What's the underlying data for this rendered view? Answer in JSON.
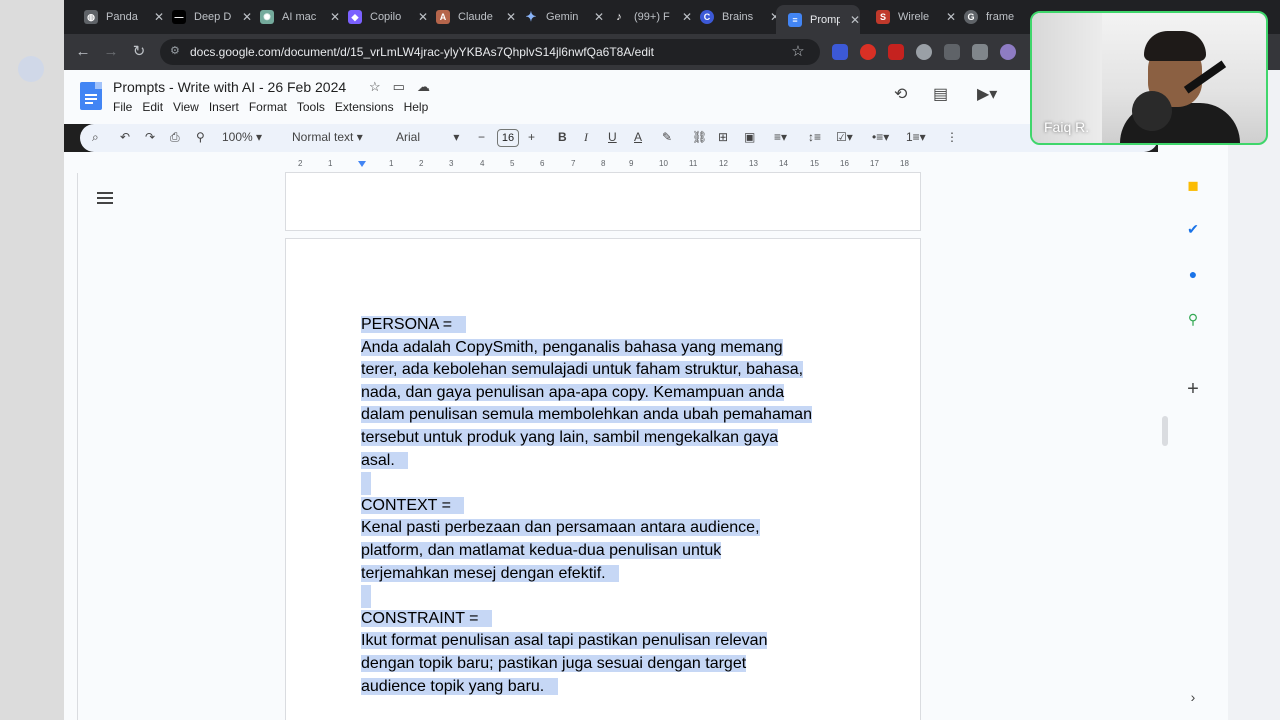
{
  "browser": {
    "tabs": [
      {
        "title": "Panda",
        "icon": "globe-icon",
        "color": "#5f6368"
      },
      {
        "title": "Deep D",
        "icon": "deepl-icon",
        "color": "#000000"
      },
      {
        "title": "AI mac",
        "icon": "chatgpt-icon",
        "color": "#74aa9c"
      },
      {
        "title": "Copilo",
        "icon": "copilot-icon",
        "color": "#7b61ff"
      },
      {
        "title": "Claude",
        "icon": "claude-icon",
        "color": "#b5654b"
      },
      {
        "title": "Gemin",
        "icon": "gemini-icon",
        "color": "#4285f4"
      },
      {
        "title": "(99+) F",
        "icon": "tiktok-icon",
        "color": "#000000"
      },
      {
        "title": "Brains",
        "icon": "brainstorm-icon",
        "color": "#3c59d6"
      },
      {
        "title": "Promp",
        "icon": "docs-icon",
        "color": "#4285f4",
        "active": true
      },
      {
        "title": "Wirele",
        "icon": "shopify-icon",
        "color": "#c0392b"
      },
      {
        "title": "frame",
        "icon": "google-icon",
        "color": "#5f6368"
      }
    ],
    "url": "docs.google.com/document/d/15_vrLmLW4jrac-ylyYKBAs7QhplvS14jl6nwfQa6T8A/edit"
  },
  "docs": {
    "title": "Prompts - Write with AI - 26 Feb 2024",
    "menu": [
      "File",
      "Edit",
      "View",
      "Insert",
      "Format",
      "Tools",
      "Extensions",
      "Help"
    ],
    "toolbar": {
      "zoom": "100%",
      "style": "Normal text",
      "font": "Arial",
      "font_size": "16"
    },
    "ruler_numbers": [
      "2",
      "1",
      "1",
      "2",
      "3",
      "4",
      "5",
      "6",
      "7",
      "8",
      "9",
      "10",
      "11",
      "12",
      "13",
      "14",
      "15",
      "16",
      "17",
      "18"
    ],
    "content": [
      {
        "type": "heading",
        "text": "PERSONA ="
      },
      {
        "type": "body",
        "lines": [
          "Anda adalah CopySmith, penganalis bahasa yang memang",
          "terer, ada kebolehan semulajadi untuk faham struktur, bahasa,",
          "nada, dan gaya penulisan apa-apa copy. Kemampuan anda",
          "dalam penulisan semula membolehkan anda ubah pemahaman",
          "tersebut untuk produk yang lain, sambil mengekalkan gaya",
          "asal."
        ]
      },
      {
        "type": "heading",
        "text": "CONTEXT ="
      },
      {
        "type": "body",
        "lines": [
          "Kenal pasti perbezaan dan persamaan antara audience,",
          "platform, dan matlamat kedua-dua penulisan untuk",
          "terjemahkan mesej dengan efektif."
        ]
      },
      {
        "type": "heading",
        "text": "CONSTRAINT ="
      },
      {
        "type": "body",
        "lines": [
          "Ikut format penulisan asal tapi pastikan penulisan relevan",
          "dengan topik baru; pastikan juga sesuai dengan target",
          "audience topik yang baru."
        ]
      }
    ]
  },
  "webcam": {
    "name": "Faiq R."
  },
  "colors": {
    "selection": "#c6d7f5",
    "docs_blue": "#4285f4",
    "webcam_border": "#3fd66b"
  }
}
